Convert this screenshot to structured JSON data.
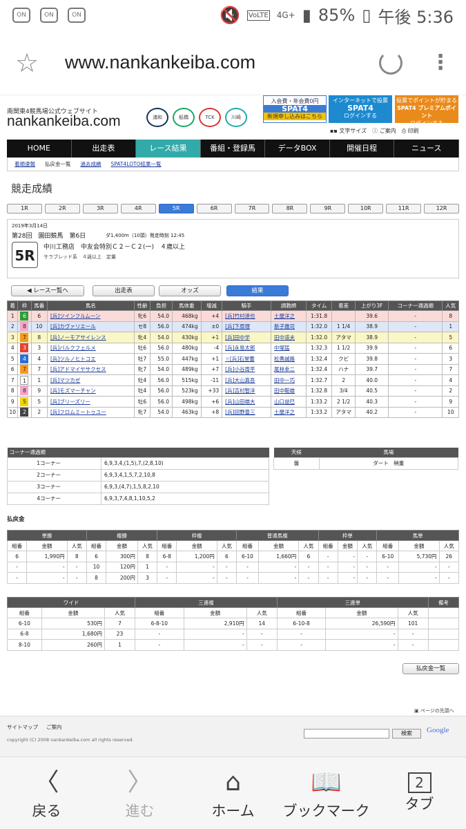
{
  "status": {
    "signal": "4G+",
    "battery": "85%",
    "time": "午後 5:36",
    "left_icons": [
      "ON",
      "ON",
      "ON"
    ],
    "volte": "VoLTE"
  },
  "browser": {
    "url": "www.nankankeiba.com"
  },
  "site": {
    "subtitle": "南関東4競馬場公式ウェブサイト",
    "name": "nankankeiba.com",
    "logos": [
      "浦和",
      "船橋",
      "TCK",
      "川崎"
    ]
  },
  "banners": [
    {
      "top": "入会費・年会費0円",
      "title": "SPAT4",
      "bottom": "新規申し込みはこちら",
      "color": "#3a7bd5"
    },
    {
      "top": "インターネットで投票",
      "title": "SPAT4",
      "bottom": "ログインする",
      "color": "#1d8ad0"
    },
    {
      "top": "投票でポイントが貯まる",
      "title": "SPAT4 プレミアムポイント",
      "bottom": "ログインする",
      "color": "#e98a1a"
    }
  ],
  "tools": {
    "font_size": "文字サイズ",
    "guide": "ご案内",
    "print": "印刷"
  },
  "nav": [
    "HOME",
    "出走表",
    "レース結果",
    "番組・登録馬",
    "データBOX",
    "開催日程",
    "ニュース"
  ],
  "subnav": [
    "着順速報",
    "払戻金一覧",
    "過去成績",
    "SPAT4LOTO結果一覧"
  ],
  "page_title": "競走成績",
  "race_tabs": [
    "1R",
    "2R",
    "3R",
    "4R",
    "5R",
    "6R",
    "7R",
    "8R",
    "9R",
    "10R",
    "11R",
    "12R"
  ],
  "race": {
    "date": "2019年3月14日",
    "meeting": "第28回　園田競馬　第6日",
    "distance": "ダ1,400m（10頭）発走時刻 12:45",
    "number": "5R",
    "name": "中川工務店　中友会特別Ｃ２－Ｃ２(一)　４歳以上",
    "conditions": "サラブレッド系　４歳以上　定量"
  },
  "buttons": {
    "back": "レース一覧へ",
    "card": "出走表",
    "odds": "オッズ",
    "result": "結果"
  },
  "result_headers": [
    "着",
    "枠",
    "馬番",
    "馬名",
    "性齢",
    "負担",
    "馬体重",
    "増減",
    "騎手",
    "調教師",
    "タイム",
    "着差",
    "上がり3F",
    "コーナー通過順",
    "人気"
  ],
  "results": [
    [
      "1",
      "6",
      "6",
      "[兵]ツインフルムーン",
      "牝6",
      "54.0",
      "468kg",
      "+4",
      "[兵]竹村達也",
      "土屋洋之",
      "1:31.8",
      "",
      "39.6",
      "-",
      "8"
    ],
    [
      "2",
      "8",
      "10",
      "[兵]カヴァリエール",
      "セ8",
      "56.0",
      "474kg",
      "±0",
      "[兵]下原理",
      "新子雅司",
      "1:32.0",
      "1 1/4",
      "38.9",
      "-",
      "1"
    ],
    [
      "3",
      "7",
      "8",
      "[兵]ノーモアサイレンス",
      "牝4",
      "54.0",
      "430kg",
      "+1",
      "[兵]田中学",
      "田中道夫",
      "1:32.0",
      "アタマ",
      "38.9",
      "-",
      "5"
    ],
    [
      "4",
      "3",
      "3",
      "[兵]バルクフェルメ",
      "牡6",
      "56.0",
      "480kg",
      "-4",
      "[兵]永島太郎",
      "中塚猛",
      "1:32.3",
      "1 1/2",
      "39.9",
      "-",
      "6"
    ],
    [
      "5",
      "4",
      "4",
      "[兵]ツルノヒトコエ",
      "牡7",
      "55.0",
      "447kg",
      "+1",
      "☆[兵]石堂響",
      "松勇誠路",
      "1:32.4",
      "クビ",
      "39.8",
      "-",
      "3"
    ],
    [
      "6",
      "7",
      "7",
      "[兵]アドマイヤサクセス",
      "牝7",
      "54.0",
      "489kg",
      "+7",
      "[兵]小谷周平",
      "尾林幸二",
      "1:32.4",
      "ハナ",
      "39.7",
      "-",
      "7"
    ],
    [
      "7",
      "1",
      "1",
      "[兵]マツカゼ",
      "牡4",
      "56.0",
      "515kg",
      "-11",
      "[兵]大山真吾",
      "田中一巧",
      "1:32.7",
      "2",
      "40.0",
      "-",
      "4"
    ],
    [
      "8",
      "8",
      "9",
      "[兵]モズマーチャン",
      "牡4",
      "56.0",
      "523kg",
      "+33",
      "[兵]吉村智洋",
      "田中範雄",
      "1:32.8",
      "3/4",
      "40.5",
      "-",
      "2"
    ],
    [
      "9",
      "5",
      "5",
      "[兵]ブリーズリー",
      "牡6",
      "56.0",
      "498kg",
      "+6",
      "[兵]山田雄大",
      "山口益巳",
      "1:33.2",
      "2 1/2",
      "40.3",
      "-",
      "9"
    ],
    [
      "10",
      "2",
      "2",
      "[兵]フロムミートゥユー",
      "牝7",
      "54.0",
      "463kg",
      "+8",
      "[兵]田野豊三",
      "土屋洋之",
      "1:33.2",
      "アタマ",
      "40.2",
      "-",
      "10"
    ]
  ],
  "waku_colors": {
    "1": "#ffffff",
    "2": "#444444",
    "3": "#e34234",
    "4": "#2f6fd0",
    "5": "#f2d400",
    "6": "#2e9e3a",
    "7": "#f39a1e",
    "8": "#f4a7c8"
  },
  "corner": {
    "title": "コーナー通過順",
    "rows": [
      [
        "1コーナー",
        "6,9,3,4,(1,5),7,(2,8,10)"
      ],
      [
        "2コーナー",
        "6,9,3,4,1,5,7,2,10,8"
      ],
      [
        "3コーナー",
        "6,9,3,(4,7),1,5,8,2,10"
      ],
      [
        "4コーナー",
        "6,9,3,7,4,8,1,10,5,2"
      ]
    ]
  },
  "weather": {
    "h1": "天候",
    "h2": "馬場",
    "weather": "曇",
    "track": "ダート　稍重"
  },
  "payout_label": "払戻金",
  "pay1": {
    "groups": [
      "単勝",
      "複勝",
      "枠複",
      "普通馬複",
      "枠単",
      "馬単"
    ],
    "sub": [
      "組番",
      "金額",
      "人気"
    ],
    "rows": [
      [
        "6",
        "1,990円",
        "8",
        "6",
        "300円",
        "8",
        "6-8",
        "1,200円",
        "6",
        "6-10",
        "1,660円",
        "6",
        "-",
        "-",
        "-",
        "6-10",
        "5,730円",
        "26"
      ],
      [
        "-",
        "-",
        "-",
        "10",
        "120円",
        "1",
        "-",
        "-",
        "-",
        "-",
        "-",
        "-",
        "-",
        "-",
        "-",
        "-",
        "-",
        "-"
      ],
      [
        "-",
        "-",
        "-",
        "8",
        "200円",
        "3",
        "-",
        "-",
        "-",
        "-",
        "-",
        "-",
        "-",
        "-",
        "-",
        "-",
        "-",
        "-"
      ]
    ]
  },
  "pay2": {
    "groups": [
      "ワイド",
      "三連複",
      "三連単",
      "備考"
    ],
    "sub": [
      "組番",
      "金額",
      "人気"
    ],
    "rows": [
      [
        "6-10",
        "530円",
        "7",
        "6-8-10",
        "2,910円",
        "14",
        "6-10-8",
        "26,590円",
        "101"
      ],
      [
        "6-8",
        "1,680円",
        "23",
        "-",
        "-",
        "-",
        "-",
        "-",
        "-"
      ],
      [
        "8-10",
        "260円",
        "1",
        "-",
        "-",
        "-",
        "-",
        "-",
        "-"
      ]
    ]
  },
  "payall": "払戻金一覧",
  "pagetop": "ページの先頭へ",
  "footer": {
    "links": [
      "サイトマップ",
      "ご案内"
    ],
    "copyright": "copyright (C) 2008 nankankeiba.com all rights reserved.",
    "search": "検索",
    "google": "Google"
  },
  "bottombar": [
    "戻る",
    "進む",
    "ホーム",
    "ブックマーク",
    "タブ"
  ],
  "tab_count": "2"
}
